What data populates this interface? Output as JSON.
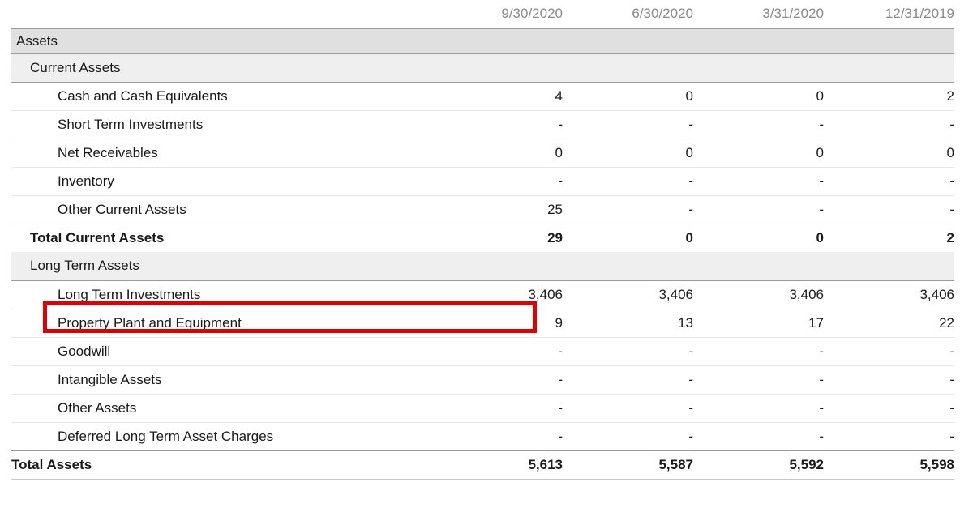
{
  "table": {
    "label_header": "",
    "columns": [
      "9/30/2020",
      "6/30/2020",
      "3/31/2020",
      "12/31/2019"
    ],
    "rows": [
      {
        "type": "section-top",
        "label": "Assets",
        "values": [
          "",
          "",
          "",
          ""
        ]
      },
      {
        "type": "section-sub",
        "label": "Current Assets",
        "values": [
          "",
          "",
          "",
          ""
        ]
      },
      {
        "type": "item",
        "label": "Cash and Cash Equivalents",
        "values": [
          "4",
          "0",
          "0",
          "2"
        ]
      },
      {
        "type": "item",
        "label": "Short Term Investments",
        "values": [
          "-",
          "-",
          "-",
          "-"
        ]
      },
      {
        "type": "item",
        "label": "Net Receivables",
        "values": [
          "0",
          "0",
          "0",
          "0"
        ]
      },
      {
        "type": "item",
        "label": "Inventory",
        "values": [
          "-",
          "-",
          "-",
          "-"
        ]
      },
      {
        "type": "item",
        "label": "Other Current Assets",
        "values": [
          "25",
          "-",
          "-",
          "-"
        ]
      },
      {
        "type": "total-sub",
        "label": "Total Current Assets",
        "values": [
          "29",
          "0",
          "0",
          "2"
        ]
      },
      {
        "type": "section-sub",
        "label": "Long Term Assets",
        "values": [
          "",
          "",
          "",
          ""
        ]
      },
      {
        "type": "item",
        "label": "Long Term Investments",
        "values": [
          "3,406",
          "3,406",
          "3,406",
          "3,406"
        ],
        "highlighted": true
      },
      {
        "type": "item",
        "label": "Property Plant and Equipment",
        "values": [
          "9",
          "13",
          "17",
          "22"
        ]
      },
      {
        "type": "item",
        "label": "Goodwill",
        "values": [
          "-",
          "-",
          "-",
          "-"
        ]
      },
      {
        "type": "item",
        "label": "Intangible Assets",
        "values": [
          "-",
          "-",
          "-",
          "-"
        ]
      },
      {
        "type": "item",
        "label": "Other Assets",
        "values": [
          "-",
          "-",
          "-",
          "-"
        ]
      },
      {
        "type": "item",
        "label": "Deferred Long Term Asset Charges",
        "values": [
          "-",
          "-",
          "-",
          "-"
        ]
      },
      {
        "type": "total-main",
        "label": "Total Assets",
        "values": [
          "5,613",
          "5,587",
          "5,592",
          "5,598"
        ]
      }
    ]
  },
  "annotation": {
    "highlight_color": "#e00000",
    "highlight_target_label": "Long Term Investments",
    "highlight_target_value": "3,406",
    "highlight_target_column": "9/30/2020"
  },
  "colors": {
    "section_top_bg": "#e0e0e0",
    "section_sub_bg": "#efefef",
    "row_border": "#e8e8e8",
    "strong_border": "#9a9a9a",
    "header_text": "#8a8a8a",
    "body_text": "#1a1a1a"
  }
}
